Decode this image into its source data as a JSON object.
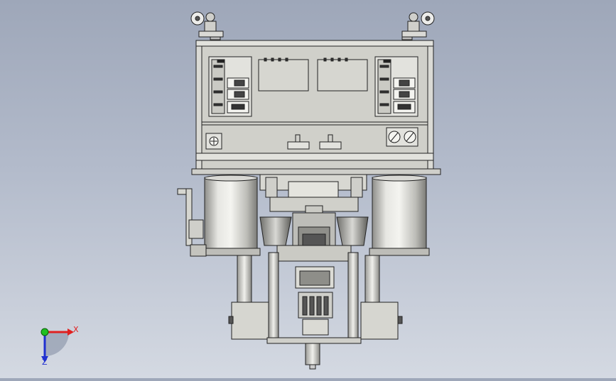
{
  "viewport": {
    "background_top": "#9ea7b9",
    "background_bottom": "#d4d9e2"
  },
  "model": {
    "part_color": "#d9d9d3",
    "dark_color": "#3a3a3a",
    "cylinder_color": "#c8c8c4"
  },
  "triad": {
    "x_label": "X",
    "z_label": "Z",
    "x_color": "#e02020",
    "y_color": "#20c020",
    "z_color": "#2030d0"
  }
}
